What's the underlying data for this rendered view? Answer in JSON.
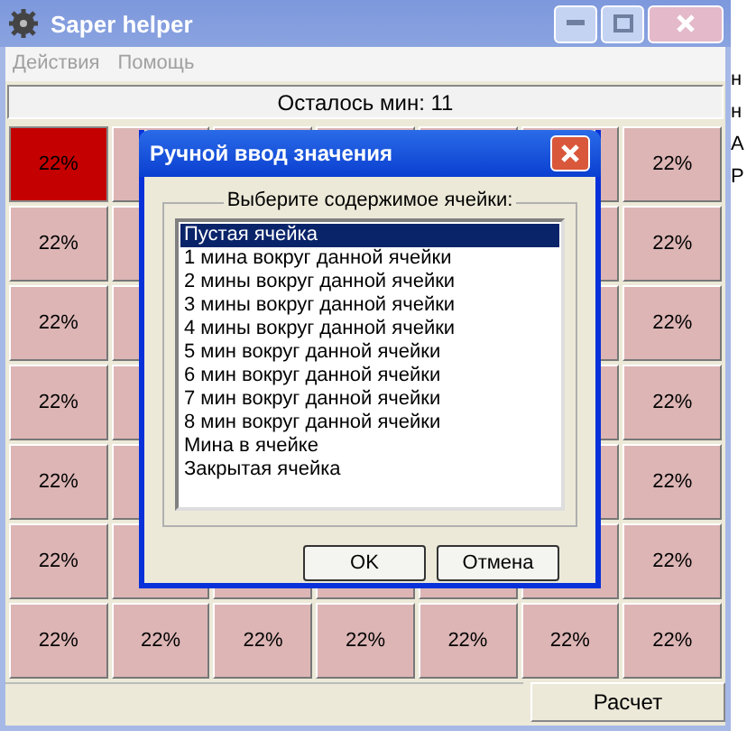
{
  "window": {
    "title": "Saper helper"
  },
  "menu": [
    "Действия",
    "Помощь"
  ],
  "status": "Осталось мин: 11",
  "grid": [
    {
      "cells": [
        {
          "text": "22%",
          "selected": true
        },
        {
          "selected": false
        },
        {},
        {},
        {},
        {
          "selected": false
        },
        {
          "text": "22%",
          "selected": false
        }
      ]
    },
    {
      "cells": [
        {
          "text": "22%",
          "selected": false
        },
        {
          "selected": false
        },
        {},
        {},
        {},
        {
          "selected": false
        },
        {
          "text": "22%",
          "selected": false
        }
      ]
    },
    {
      "cells": [
        {
          "text": "22%",
          "selected": false
        },
        {
          "selected": false
        },
        {},
        {},
        {},
        {
          "selected": false
        },
        {
          "text": "22%",
          "selected": false
        }
      ]
    },
    {
      "cells": [
        {
          "text": "22%",
          "selected": false
        },
        {
          "selected": false
        },
        {},
        {},
        {},
        {
          "selected": false
        },
        {
          "text": "22%",
          "selected": false
        }
      ]
    },
    {
      "cells": [
        {
          "text": "22%",
          "selected": false
        },
        {
          "selected": false
        },
        {},
        {},
        {},
        {
          "selected": false
        },
        {
          "text": "22%",
          "selected": false
        }
      ]
    },
    {
      "cells": [
        {
          "text": "22%",
          "selected": false
        },
        {
          "selected": false
        },
        {},
        {},
        {},
        {
          "selected": false
        },
        {
          "text": "22%",
          "selected": false
        }
      ]
    },
    {
      "cells": [
        {
          "text": "22%",
          "selected": false
        },
        {
          "text": "22%",
          "selected": false
        },
        {
          "text": "22%",
          "selected": false
        },
        {
          "text": "22%",
          "selected": false
        },
        {
          "text": "22%",
          "selected": false
        },
        {
          "text": "22%",
          "selected": false
        },
        {
          "text": "22%",
          "selected": false
        }
      ]
    }
  ],
  "dialog": {
    "title": "Ручной ввод значения",
    "group_label": "Выберите содержимое ячейки:",
    "options": [
      {
        "label": "Пустая ячейка",
        "selected": true
      },
      {
        "label": "1 мина вокруг данной ячейки",
        "selected": false
      },
      {
        "label": "2 мины вокруг данной ячейки",
        "selected": false
      },
      {
        "label": "3 мины вокруг данной ячейки",
        "selected": false
      },
      {
        "label": "4 мины вокруг данной ячейки",
        "selected": false
      },
      {
        "label": "5 мин вокруг данной ячейки",
        "selected": false
      },
      {
        "label": "6 мин вокруг данной ячейки",
        "selected": false
      },
      {
        "label": "7 мин вокруг данной ячейки",
        "selected": false
      },
      {
        "label": "8 мин вокруг данной ячейки",
        "selected": false
      },
      {
        "label": "Мина в ячейке",
        "selected": false
      },
      {
        "label": "Закрытая ячейка",
        "selected": false
      }
    ],
    "buttons": [
      "OK",
      "Отмена"
    ]
  },
  "calc_button": "Расчет",
  "background_text": [
    "н",
    "н",
    "А",
    "Р"
  ]
}
